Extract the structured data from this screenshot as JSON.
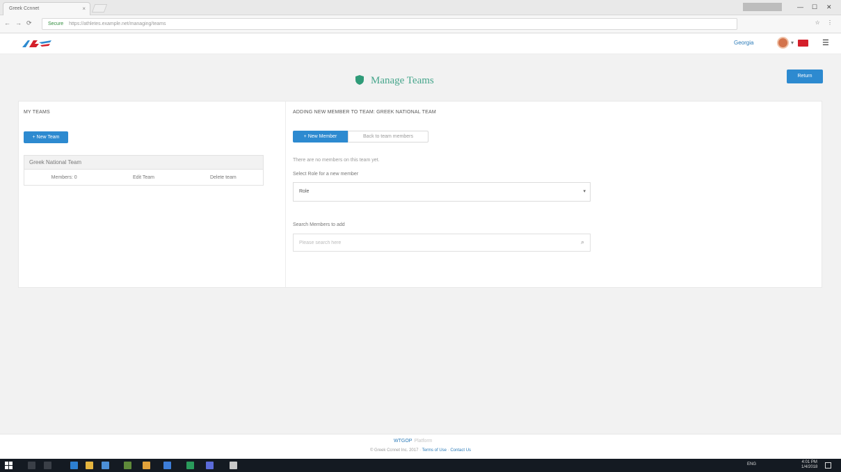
{
  "browser": {
    "tab_title": "Greek Ccnnet",
    "tab_close": "×",
    "window_controls": [
      "—",
      "☐",
      "✕"
    ],
    "nav_back": "←",
    "nav_forward": "→",
    "nav_reload": "⟳",
    "secure_label": "Secure",
    "url": "https://athletes.example.net/managing/teams"
  },
  "header": {
    "user_name": "Georgia",
    "menu_icon": "☰"
  },
  "page": {
    "title": "Manage Teams",
    "return_button": "Return"
  },
  "left": {
    "section_title": "MY TEAMS",
    "new_team_button": "+ New Team",
    "team": {
      "name": "Greek National Team",
      "members_link": "Members: 0",
      "edit_link": "Edit Team",
      "delete_link": "Delete team"
    }
  },
  "right": {
    "section_title": "ADDING NEW MEMBER TO TEAM: GREEK NATIONAL TEAM",
    "new_member_button": "+ New Member",
    "back_button": "Back to team members",
    "info_text": "There are no members on this team yet.",
    "role_label": "Select Role for a new member",
    "role_value": "Role",
    "search_label": "Search Members to add",
    "search_placeholder": "Please search here"
  },
  "footer": {
    "brand": "WTGOP",
    "brand_suffix": "Platform",
    "copyright": "© Greek Ccnnet Inc. 2017 · ",
    "terms_link": "Terms of Use",
    "contact_link": "Contact Us"
  },
  "taskbar": {
    "tray_text": "ENG",
    "time": "4:01 PM",
    "date": "1/4/2018"
  },
  "colors": {
    "primary": "#2d8ad0",
    "title_green": "#45a58b",
    "link_blue": "#2a7ab8",
    "taskbar": "#141a22"
  }
}
